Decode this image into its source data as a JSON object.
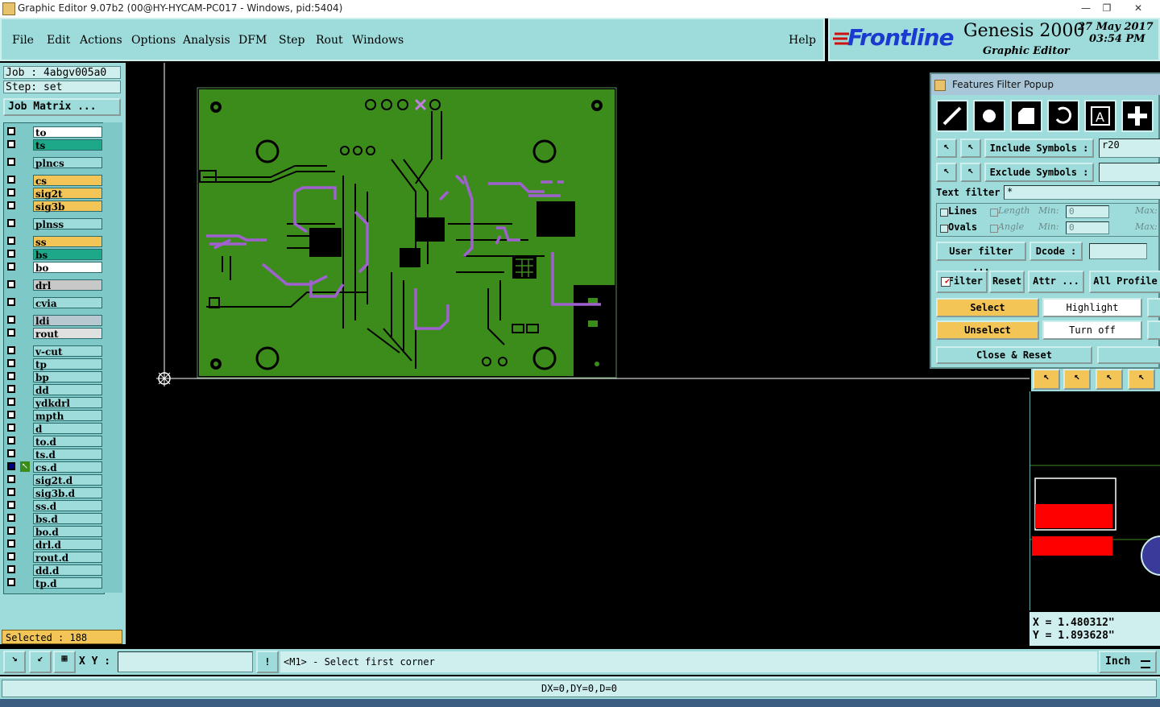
{
  "window": {
    "title": "Graphic Editor 9.07b2 (00@HY-HYCAM-PC017 - Windows, pid:5404)"
  },
  "menu": {
    "items": [
      "File",
      "Edit",
      "Actions",
      "Options",
      "Analysis",
      "DFM",
      "Step",
      "Rout",
      "Windows"
    ],
    "help": "Help"
  },
  "brand": {
    "logo": "Frontline",
    "product": "Genesis 2000",
    "subtitle": "Graphic Editor",
    "date": "27 May 2017",
    "time": "03:54 PM"
  },
  "left": {
    "job": "Job : 4abgv005a0",
    "step": "Step: set",
    "job_matrix": "Job Matrix ...",
    "layers": [
      {
        "name": "to",
        "color": "#ffffff"
      },
      {
        "name": "ts",
        "color": "#1ea88a"
      },
      {
        "name": "plncs",
        "color": "#9edcdc"
      },
      {
        "name": "cs",
        "color": "#f3c557"
      },
      {
        "name": "sig2t",
        "color": "#f3c557"
      },
      {
        "name": "sig3b",
        "color": "#f3c557"
      },
      {
        "name": "plnss",
        "color": "#9edcdc"
      },
      {
        "name": "ss",
        "color": "#f3c557"
      },
      {
        "name": "bs",
        "color": "#1ea88a"
      },
      {
        "name": "bo",
        "color": "#ffffff"
      },
      {
        "name": "drl",
        "color": "#c8c8c8"
      },
      {
        "name": "cvia",
        "color": "#9edcdc"
      },
      {
        "name": "ldi",
        "color": "#b8c8d0"
      },
      {
        "name": "rout",
        "color": "#e0e0e0"
      },
      {
        "name": "v-cut",
        "color": "#9edcdc"
      },
      {
        "name": "tp",
        "color": "#9edcdc"
      },
      {
        "name": "bp",
        "color": "#9edcdc"
      },
      {
        "name": "dd",
        "color": "#9edcdc"
      },
      {
        "name": "ydkdrl",
        "color": "#9edcdc"
      },
      {
        "name": "mpth",
        "color": "#9edcdc"
      },
      {
        "name": "d",
        "color": "#9edcdc"
      },
      {
        "name": "to.d",
        "color": "#9edcdc"
      },
      {
        "name": "ts.d",
        "color": "#9edcdc"
      },
      {
        "name": "cs.d",
        "color": "#9edcdc"
      },
      {
        "name": "sig2t.d",
        "color": "#9edcdc"
      },
      {
        "name": "sig3b.d",
        "color": "#9edcdc"
      },
      {
        "name": "ss.d",
        "color": "#9edcdc"
      },
      {
        "name": "bs.d",
        "color": "#9edcdc"
      },
      {
        "name": "bo.d",
        "color": "#9edcdc"
      },
      {
        "name": "drl.d",
        "color": "#9edcdc"
      },
      {
        "name": "rout.d",
        "color": "#9edcdc"
      },
      {
        "name": "dd.d",
        "color": "#9edcdc"
      },
      {
        "name": "tp.d",
        "color": "#9edcdc"
      }
    ],
    "selected": "Selected : 188"
  },
  "filter_popup": {
    "title": "Features Filter Popup",
    "include_label": "Include Symbols :",
    "include_value": "r20",
    "exclude_label": "Exclude Symbols :",
    "exclude_value": "",
    "text_filter_label": "Text filter",
    "text_filter_value": "*",
    "lines_label": "Lines",
    "ovals_label": "Ovals",
    "length_label": "Length",
    "angle_label": "Angle",
    "min_label": "Min:",
    "max_label": "Max:",
    "min_len_value": "0",
    "min_ang_value": "0",
    "user_filter": "User filter ...",
    "dcode_label": "Dcode :",
    "filter": "Filter",
    "reset": "Reset",
    "attr": "Attr ...",
    "all_profile": "All Profile",
    "select": "Select",
    "highlight": "Highlight",
    "unselect": "Unselect",
    "turn_off": "Turn off",
    "close_reset": "Close & Reset"
  },
  "bottom": {
    "xy_label": "X Y :",
    "xy_value": "",
    "prompt": "<M1> - Select first corner",
    "units": "Inch",
    "status": "DX=0,DY=0,D=0"
  },
  "coords": {
    "x": "X = 1.480312\"",
    "y": "Y = 1.893628\""
  },
  "colors": {
    "panel": "#9edcdc",
    "board": "#3c8c1c",
    "trace": "#a060d0",
    "highlight": "#f3c557",
    "red": "#ff0000"
  }
}
